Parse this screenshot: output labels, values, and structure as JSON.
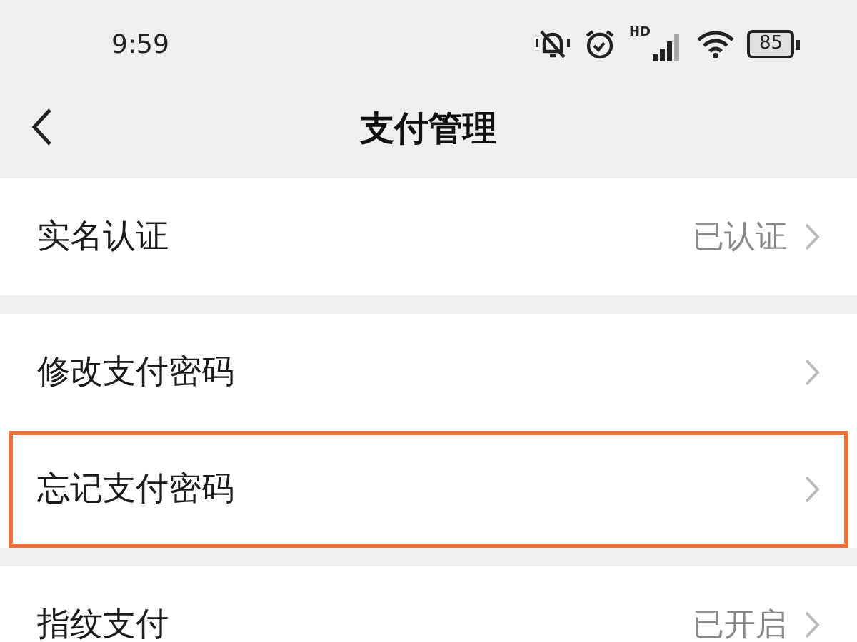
{
  "status_bar": {
    "time": "9:59",
    "network": "HD",
    "battery": "85"
  },
  "header": {
    "title": "支付管理"
  },
  "groups": [
    {
      "items": [
        {
          "label": "实名认证",
          "value": "已认证",
          "highlighted": false
        }
      ]
    },
    {
      "items": [
        {
          "label": "修改支付密码",
          "highlighted": false
        },
        {
          "label": "忘记支付密码",
          "highlighted": true
        }
      ]
    },
    {
      "items": [
        {
          "label": "指纹支付",
          "value": "已开启",
          "highlighted": false
        }
      ]
    }
  ]
}
